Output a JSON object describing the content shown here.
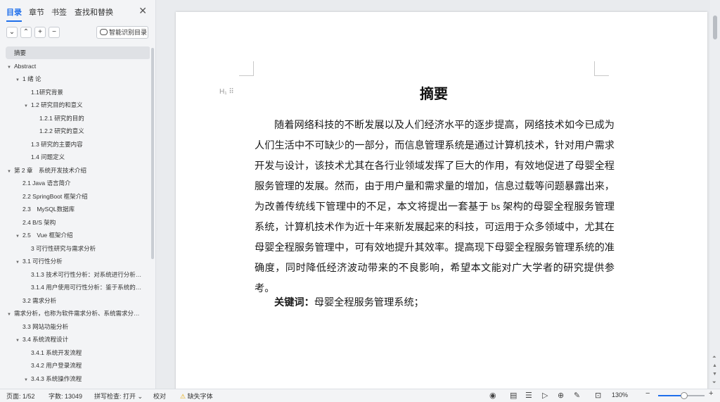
{
  "sidebar": {
    "tabs": [
      "目录",
      "章节",
      "书签",
      "查找和替换"
    ],
    "close": "✕",
    "collapse_btn": "⌄",
    "expand_btn": "⌃",
    "add_btn": "+",
    "remove_btn": "−",
    "ai_button": "智能识别目录",
    "toc": [
      {
        "label": "摘要",
        "level": 1,
        "caret": ""
      },
      {
        "label": "Abstract",
        "level": 1,
        "caret": "▼"
      },
      {
        "label": "1 绪 论",
        "level": 2,
        "caret": "▼"
      },
      {
        "label": "1.1研究背景",
        "level": 3,
        "caret": ""
      },
      {
        "label": "1.2 研究目的和意义",
        "level": 3,
        "caret": "▼"
      },
      {
        "label": "1.2.1 研究的目的",
        "level": 4,
        "caret": ""
      },
      {
        "label": "1.2.2 研究的意义",
        "level": 4,
        "caret": ""
      },
      {
        "label": "1.3 研究的主要内容",
        "level": 3,
        "caret": ""
      },
      {
        "label": "1.4 问题定义",
        "level": 3,
        "caret": ""
      },
      {
        "label": "第 2 章　系统开发技术介绍",
        "level": 1,
        "caret": "▼"
      },
      {
        "label": "2.1 Java 语言简介",
        "level": 2,
        "caret": ""
      },
      {
        "label": "2.2 SpringBoot 框架介绍",
        "level": 2,
        "caret": ""
      },
      {
        "label": "2.3　MySQL数据库",
        "level": 2,
        "caret": ""
      },
      {
        "label": "2.4 B/S 架构",
        "level": 2,
        "caret": ""
      },
      {
        "label": "2.5　Vue 框架介绍",
        "level": 2,
        "caret": "▼"
      },
      {
        "label": "3 可行性研究与需求分析",
        "level": 3,
        "caret": ""
      },
      {
        "label": "3.1 可行性分析",
        "level": 2,
        "caret": "▼"
      },
      {
        "label": "3.1.3 技术可行性分析：对系统进行分析…",
        "level": 3,
        "caret": ""
      },
      {
        "label": "3.1.4 用户使用可行性分析：鉴于系统的…",
        "level": 3,
        "caret": ""
      },
      {
        "label": "3.2 需求分析",
        "level": 2,
        "caret": ""
      },
      {
        "label": "需求分析，也称为软件需求分析、系统需求分…",
        "level": 1,
        "caret": "▼"
      },
      {
        "label": "3.3 网站功能分析",
        "level": 2,
        "caret": ""
      },
      {
        "label": "3.4 系统流程设计",
        "level": 2,
        "caret": "▼"
      },
      {
        "label": "3.4.1 系统开发流程",
        "level": 3,
        "caret": ""
      },
      {
        "label": "3.4.2 用户登录流程",
        "level": 3,
        "caret": ""
      },
      {
        "label": "3.4.3 系统操作流程",
        "level": 3,
        "caret": "▼"
      }
    ]
  },
  "document": {
    "heading_marker": "H₁ ⠿",
    "title": "摘要",
    "body": "随着网络科技的不断发展以及人们经济水平的逐步提高，网络技术如今已成为人们生活中不可缺少的一部分，而信息管理系统是通过计算机技术，针对用户需求开发与设计，该技术尤其在各行业领域发挥了巨大的作用，有效地促进了母婴全程服务管理的发展。然而，由于用户量和需求量的增加，信息过载等问题暴露出来，为改善传统线下管理中的不足，本文将提出一套基于 bs 架构的母婴全程服务管理系统，计算机技术作为近十年来新发展起来的科技，可运用于众多领域中，尤其在母婴全程服务管理中，可有效地提升其效率。提高现下母婴全程服务管理系统的准确度，同时降低经济波动带来的不良影响，希望本文能对广大学者的研究提供参考。",
    "keywords_label": "关键词：",
    "keywords_value": "母婴全程服务管理系统；"
  },
  "statusbar": {
    "page": "页面: 1/52",
    "words": "字数: 13049",
    "spellcheck": "拼写检查: 打开 ⌄",
    "proofread": "校对",
    "missing_font": "缺失字体",
    "zoom": "130%",
    "zoom_fraction": 0.55,
    "icons": [
      "eye-icon",
      "page-view-icon",
      "outline-view-icon",
      "play-icon",
      "web-icon",
      "pen-icon",
      "fit-icon"
    ]
  }
}
